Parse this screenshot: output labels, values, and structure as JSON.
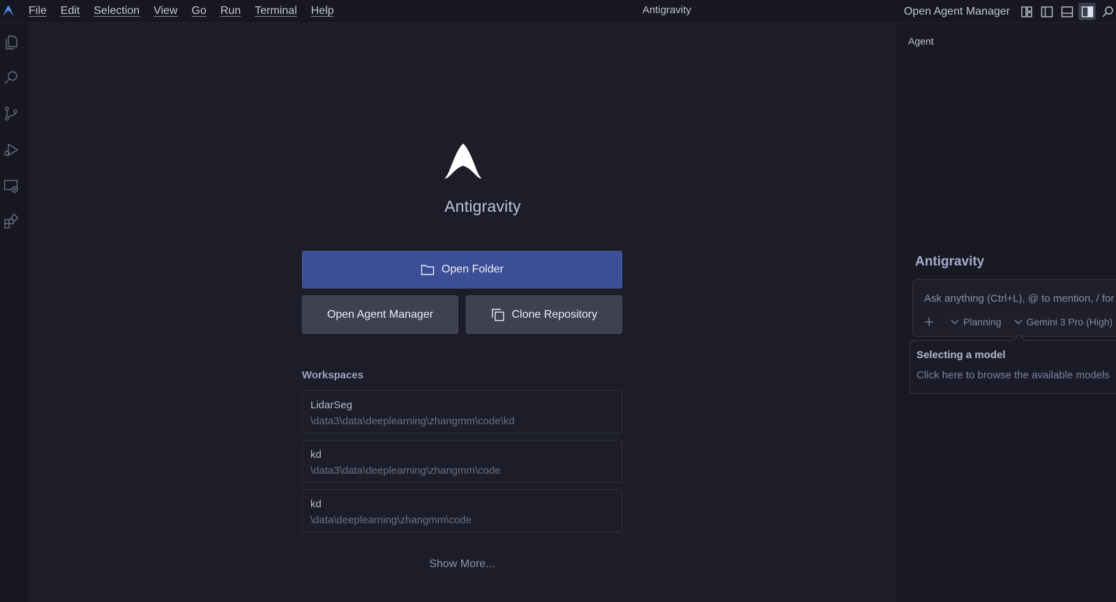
{
  "titlebar": {
    "menu": [
      "File",
      "Edit",
      "Selection",
      "View",
      "Go",
      "Run",
      "Terminal",
      "Help"
    ],
    "window_title": "Antigravity",
    "open_agent_manager": "Open Agent Manager"
  },
  "welcome": {
    "title": "Antigravity",
    "open_folder": "Open Folder",
    "open_agent_manager": "Open Agent Manager",
    "clone_repository": "Clone Repository",
    "workspaces_title": "Workspaces",
    "workspaces": [
      {
        "name": "LidarSeg",
        "path": "\\data3\\data\\deeplearning\\zhangmm\\code\\kd"
      },
      {
        "name": "kd",
        "path": "\\data3\\data\\deeplearning\\zhangmm\\code"
      },
      {
        "name": "kd",
        "path": "\\data\\deeplearning\\zhangmm\\code"
      }
    ],
    "show_more": "Show More..."
  },
  "agent_panel": {
    "tab": "Agent",
    "title": "Antigravity",
    "input_placeholder": "Ask anything (Ctrl+L), @ to mention, / for workflows",
    "mode": "Planning",
    "model": "Gemini 3 Pro (High)",
    "tooltip_title": "Selecting a model",
    "tooltip_body": "Click here to browse the available models"
  },
  "colors": {
    "accent": "#3c4f96",
    "background": "#1c1d29",
    "sidebar": "#161720"
  }
}
